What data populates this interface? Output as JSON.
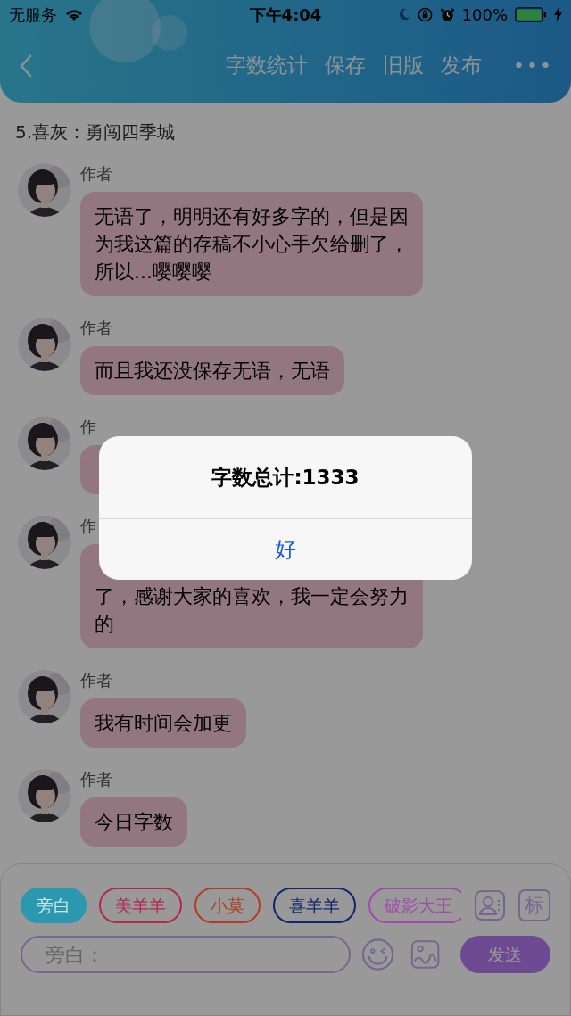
{
  "status_bar": {
    "carrier": "无服务",
    "time": "下午4:04",
    "battery": "100%"
  },
  "nav": {
    "actions": [
      "字数统计",
      "保存",
      "旧版",
      "发布"
    ],
    "more": "•••"
  },
  "title": "5.喜灰：勇闯四季城",
  "messages": [
    {
      "author": "作者",
      "text": "无语了，明明还有好多字的，但是因为我这篇的存稿不小心手欠给删了，所以...嘤嘤嘤"
    },
    {
      "author": "作者",
      "text": "而且我还没保存无语，无语"
    },
    {
      "author": "作",
      "covered_top": true
    },
    {
      "author": "作",
      "text": "了，感谢大家的喜欢，我一定会努力的",
      "covered_top": true
    },
    {
      "author": "作者",
      "text": "我有时间会加更"
    },
    {
      "author": "作者",
      "text": "今日字数"
    }
  ],
  "alert": {
    "message": "字数总计:1333",
    "button": "好"
  },
  "roles": [
    {
      "label": "旁白",
      "selected": true,
      "color": "#2b98b0"
    },
    {
      "label": "美羊羊",
      "selected": false,
      "color": "#b3284e"
    },
    {
      "label": "小莫",
      "selected": false,
      "color": "#b23d24"
    },
    {
      "label": "喜羊羊",
      "selected": false,
      "color": "#10276a"
    },
    {
      "label": "破影大王",
      "selected": false,
      "color": "#a44aad"
    }
  ],
  "tag_button": "标",
  "input": {
    "placeholder": "旁白："
  },
  "send": "发送"
}
